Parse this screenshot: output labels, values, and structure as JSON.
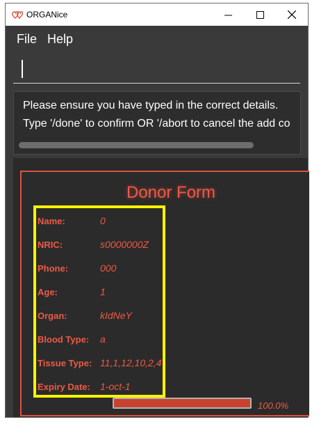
{
  "window": {
    "title": "ORGANice",
    "icon": "heart-pair-icon",
    "accent": "#e0523f"
  },
  "menu": {
    "items": [
      "File",
      "Help"
    ]
  },
  "command_box": {
    "value": ""
  },
  "result": {
    "lines": [
      "Please ensure you have typed in the correct details.",
      "Type '/done' to confirm OR '/abort to cancel the add co"
    ]
  },
  "form": {
    "title": "Donor Form",
    "fields": [
      {
        "label": "Name:",
        "value": "0"
      },
      {
        "label": "NRIC:",
        "value": "s0000000Z"
      },
      {
        "label": "Phone:",
        "value": "000"
      },
      {
        "label": "Age:",
        "value": "1"
      },
      {
        "label": "Organ:",
        "value": "kIdNeY"
      },
      {
        "label": "Blood Type:",
        "value": "a"
      },
      {
        "label": "Tissue Type:",
        "value": "11,1,12,10,2,4"
      },
      {
        "label": "Expiry Date:",
        "value": "1-oct-1"
      }
    ],
    "progress": {
      "fraction": 1.0,
      "text": "100.0%"
    }
  },
  "colors": {
    "highlight": "#fff200",
    "form_text": "#ef5944"
  }
}
